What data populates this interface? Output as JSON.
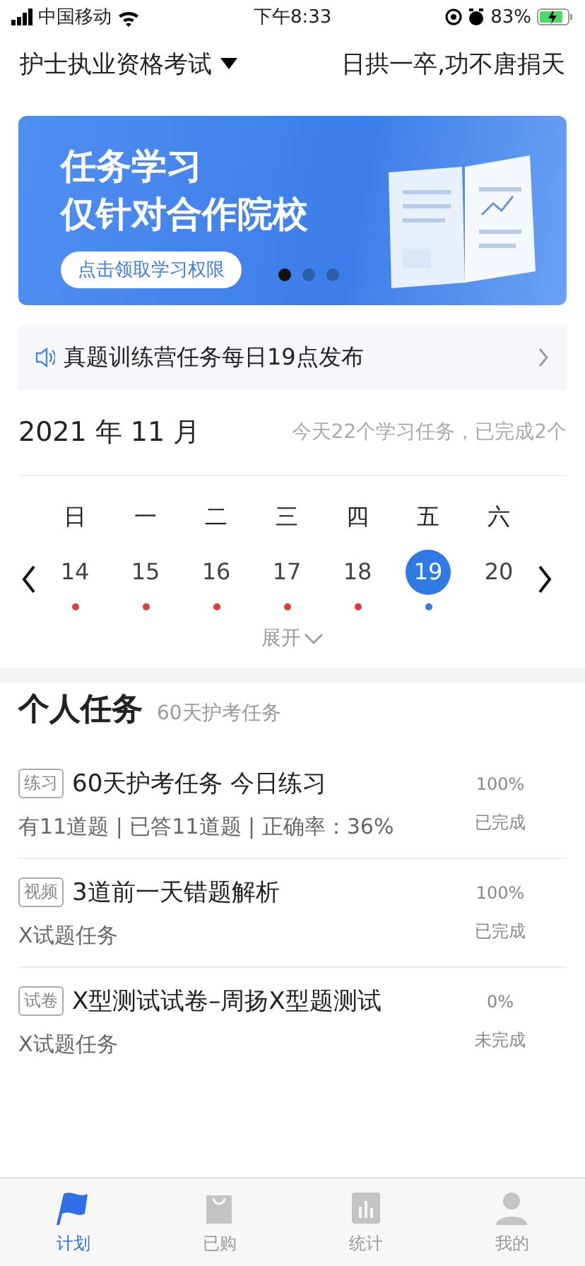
{
  "status_bar": {
    "carrier": "中国移动",
    "time": "下午8:33",
    "battery": "83%"
  },
  "header": {
    "exam": "护士执业资格考试",
    "motto": "日拱一卒,功不唐捐天"
  },
  "banner": {
    "title_lines": [
      "任务学习",
      "仅针对合作院校"
    ],
    "button": "点击领取学习权限",
    "dots": [
      {
        "selected": true
      },
      {
        "selected": false
      },
      {
        "selected": false
      }
    ]
  },
  "notice": {
    "text": "真题训练营任务每日19点发布"
  },
  "calendar": {
    "month": "2021 年 11 月",
    "summary": "今天22个学习任务，已完成2个",
    "weekdays": [
      "日",
      "一",
      "二",
      "三",
      "四",
      "五",
      "六"
    ],
    "days": [
      {
        "date": "14",
        "selected": false,
        "color": "#e53935"
      },
      {
        "date": "15",
        "selected": false,
        "color": "#e53935"
      },
      {
        "date": "16",
        "selected": false,
        "color": "#e53935"
      },
      {
        "date": "17",
        "selected": false,
        "color": "#e53935"
      },
      {
        "date": "18",
        "selected": false,
        "color": "#e53935"
      },
      {
        "date": "19",
        "selected": true,
        "color": "#2f7ae5"
      },
      {
        "date": "20",
        "selected": false
      }
    ],
    "expand": "展开"
  },
  "personal_tasks": {
    "title": "个人任务",
    "subtitle": "60天护考任务",
    "items": [
      {
        "tag": "练习",
        "title": "60天护考任务 今日练习",
        "detail": "有11道题 | 已答11道题 | 正确率：36%",
        "percent": "100%",
        "status": "已完成"
      },
      {
        "tag": "视频",
        "title": "3道前一天错题解析",
        "detail": "X试题任务",
        "percent": "100%",
        "status": "已完成"
      },
      {
        "tag": "试卷",
        "title": "X型测试试卷–周扬X型题测试",
        "detail": "X试题任务",
        "percent": "0%",
        "status": "未完成"
      }
    ]
  },
  "tab_bar": [
    {
      "label": "计划",
      "selected": true
    },
    {
      "label": "已购",
      "selected": false
    },
    {
      "label": "统计",
      "selected": false
    },
    {
      "label": "我的",
      "selected": false
    }
  ]
}
